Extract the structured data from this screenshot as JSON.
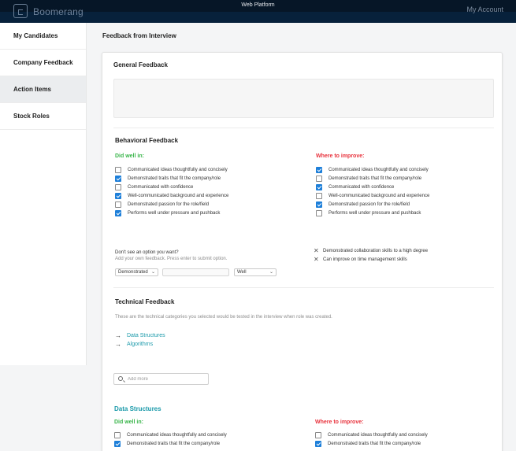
{
  "window": {
    "title": "Web Platform"
  },
  "header": {
    "brand": "Boomerang",
    "account": "My Account"
  },
  "sidebar": {
    "items": [
      {
        "label": "My Candidates",
        "active": false
      },
      {
        "label": "Company Feedback",
        "active": false
      },
      {
        "label": "Action Items",
        "active": true
      },
      {
        "label": "Stock Roles",
        "active": false
      }
    ]
  },
  "page": {
    "title": "Feedback from Interview"
  },
  "general": {
    "heading": "General Feedback",
    "value": ""
  },
  "behavioral": {
    "heading": "Behavioral Feedback",
    "did_well": {
      "label": "Did well in:",
      "items": [
        {
          "text": "Communicated ideas thoughtfully and concisely",
          "checked": false
        },
        {
          "text": "Demonstrated traits that fit the company/role",
          "checked": true
        },
        {
          "text": "Communicated with confidence",
          "checked": false
        },
        {
          "text": "Well-communicated background and experience",
          "checked": true
        },
        {
          "text": "Demonstrated passion for the role/field",
          "checked": false
        },
        {
          "text": "Performs well under pressure and pushback",
          "checked": true
        }
      ]
    },
    "improve": {
      "label": "Where to improve:",
      "items": [
        {
          "text": "Communicated ideas thoughtfully and concisely",
          "checked": true
        },
        {
          "text": "Demonstrated traits that fit the company/role",
          "checked": false
        },
        {
          "text": "Communicated with confidence",
          "checked": true
        },
        {
          "text": "Well-communicated background and experience",
          "checked": false
        },
        {
          "text": "Demonstrated passion for the role/field",
          "checked": true
        },
        {
          "text": "Performs well under pressure and pushback",
          "checked": false
        }
      ]
    },
    "custom": {
      "prompt": "Don't see an option you want?",
      "hint": "Add your own feedback. Press enter to submit option.",
      "select_left": "Demonstrated",
      "input_value": "",
      "select_right": "Well"
    },
    "added": [
      {
        "text": "Demonstrated collaboration skills to a high degree"
      },
      {
        "text": "Can improve on time management skills"
      }
    ]
  },
  "technical": {
    "heading": "Technical Feedback",
    "description": "These are the technical categories you selected would be tested in the interview when role was created.",
    "categories": [
      {
        "label": "Data Structures"
      },
      {
        "label": "Algorithms"
      }
    ],
    "add_more_placeholder": "Add more"
  },
  "data_structures": {
    "heading": "Data Structures",
    "did_well_label": "Did well in:",
    "improve_label": "Where to improve:",
    "did_well_items": [
      {
        "text": "Communicated ideas thoughtfully and concisely",
        "checked": false
      },
      {
        "text": "Demonstrated traits that fit the company/role",
        "checked": true
      }
    ],
    "improve_items": [
      {
        "text": "Communicated ideas thoughtfully and concisely",
        "checked": false
      },
      {
        "text": "Demonstrated traits that fit the company/role",
        "checked": true
      }
    ]
  },
  "colors": {
    "topbar": "#07213b",
    "accent_blue": "#1e7fd9",
    "did_well_green": "#39b54a",
    "improve_red": "#e8323c",
    "link_teal": "#1b9aaa"
  },
  "icons": {
    "logo": "logo-mark-icon",
    "remove": "close-x-icon",
    "arrow": "arrow-right-icon",
    "search": "search-icon",
    "dropdown": "chevron-down-icon"
  }
}
